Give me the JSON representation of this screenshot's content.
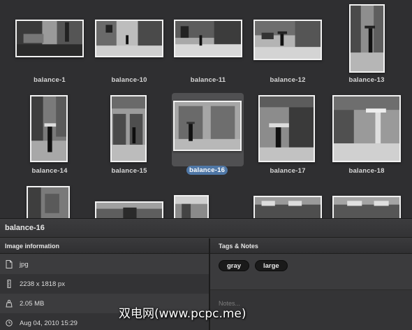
{
  "grid": {
    "thumbnails": [
      {
        "label": "balance-1"
      },
      {
        "label": "balance-10"
      },
      {
        "label": "balance-11"
      },
      {
        "label": "balance-12"
      },
      {
        "label": "balance-13"
      },
      {
        "label": "balance-14"
      },
      {
        "label": "balance-15"
      },
      {
        "label": "balance-16",
        "selected": true
      },
      {
        "label": "balance-17"
      },
      {
        "label": "balance-18"
      }
    ]
  },
  "panel": {
    "title": "balance-16",
    "info_header": "Image information",
    "tags_header": "Tags & Notes",
    "info": {
      "format": "jpg",
      "dimensions": "2238 x 1818 px",
      "size": "2.05 MB",
      "date": "Aug 04, 2010 15:29"
    },
    "tags": [
      "gray",
      "large"
    ],
    "notes_placeholder": "Notes..."
  },
  "watermark": "双电网(www.pcpc.me)"
}
